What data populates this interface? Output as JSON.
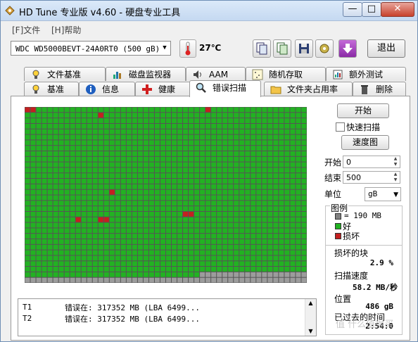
{
  "window": {
    "title": "HD Tune 专业版 v4.60 - 硬盘专业工具"
  },
  "window_controls": {
    "minimize": "—",
    "maximize": "□",
    "close": "✕"
  },
  "menu": [
    {
      "label": "[F]文件"
    },
    {
      "label": "[H]帮助"
    }
  ],
  "toolbar": {
    "drive": "WDC WD5000BEVT-24A0RT0 (500 gB)",
    "temperature": "27℃",
    "exit_label": "退出",
    "icons": [
      "copy-icon",
      "copy-all-icon",
      "save-icon",
      "options-icon",
      "download-icon"
    ]
  },
  "tabs_top": [
    {
      "label": "文件基准",
      "icon": "file-benchmark-icon"
    },
    {
      "label": "磁盘监视器",
      "icon": "disk-monitor-icon"
    },
    {
      "label": "AAM",
      "icon": "speaker-icon"
    },
    {
      "label": "随机存取",
      "icon": "random-access-icon"
    },
    {
      "label": "额外测试",
      "icon": "extra-tests-icon"
    }
  ],
  "tabs_bottom": [
    {
      "label": "基准",
      "icon": "benchmark-icon"
    },
    {
      "label": "信息",
      "icon": "info-icon"
    },
    {
      "label": "健康",
      "icon": "health-icon"
    },
    {
      "label": "错误扫描",
      "icon": "magnifier-icon",
      "active": true
    },
    {
      "label": "文件夹占用率",
      "icon": "folder-icon"
    },
    {
      "label": "删除",
      "icon": "trash-icon"
    }
  ],
  "scan_grid": {
    "cols": 50,
    "rows": 32,
    "rows_complete": 30,
    "last_row_complete_cols": 31,
    "damaged": [
      [
        0,
        0
      ],
      [
        0,
        1
      ],
      [
        1,
        13
      ],
      [
        0,
        32
      ],
      [
        15,
        15
      ],
      [
        20,
        9
      ],
      [
        20,
        13
      ],
      [
        20,
        14
      ],
      [
        19,
        28
      ],
      [
        19,
        29
      ]
    ],
    "colors": {
      "good": "#22b222",
      "damaged": "#c42020",
      "unscanned": "#9c9c9c",
      "gridline": "#555555"
    }
  },
  "side": {
    "start_button": "开始",
    "quick_scan_label": "快速扫描",
    "quick_scan_checked": false,
    "speed_map_button": "速度图",
    "start_label": "开始",
    "start_value": "0",
    "end_label": "结束",
    "end_value": "500",
    "unit_label": "单位",
    "unit_value": "gB"
  },
  "legend": {
    "title": "图例",
    "block_text": "= 190 MB",
    "good": "好",
    "damaged": "损坏",
    "block_color": "#808080",
    "good_color": "#22b222",
    "damaged_color": "#c42020"
  },
  "stats": {
    "damaged_blocks_label": "损坏的块",
    "damaged_blocks_value": "2.9 %",
    "scan_speed_label": "扫描速度",
    "scan_speed_value": "58.2 MB/秒",
    "position_label": "位置",
    "position_value": "486 gB",
    "elapsed_label": "已过去的时间",
    "elapsed_value": "2:54:0"
  },
  "log": [
    {
      "id": "T1",
      "text": "错误在:  317352 MB  (LBA 6499..."
    },
    {
      "id": "T2",
      "text": "错误在:  317352 MB  (LBA 6499..."
    }
  ],
  "watermark": "值 什么值得买"
}
